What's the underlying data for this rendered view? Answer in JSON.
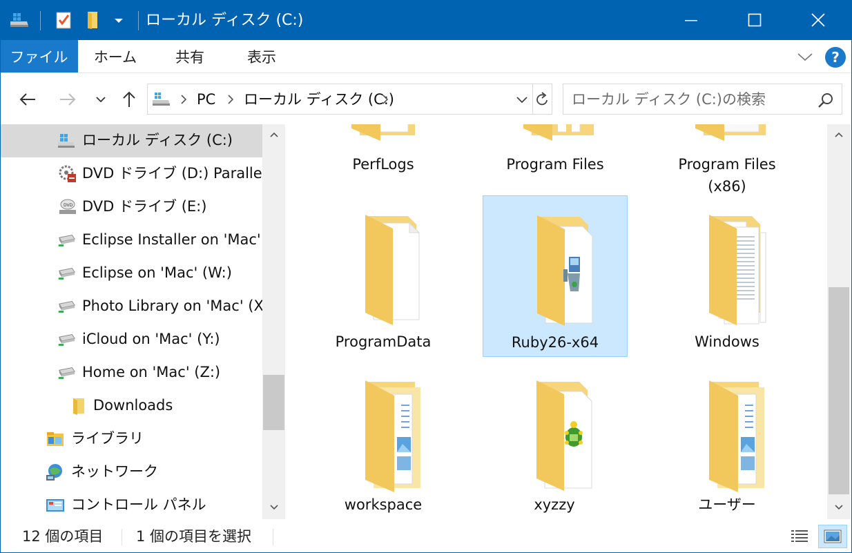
{
  "window": {
    "title": "ローカル ディスク (C:)",
    "accent": "#0063b1",
    "buttons": [
      "minimize-icon",
      "maximize-icon",
      "close-icon"
    ]
  },
  "quick_access": [
    "drive-icon",
    "properties-icon",
    "new-folder-icon",
    "customize-dropdown-icon"
  ],
  "ribbon": {
    "tabs": [
      "ファイル",
      "ホーム",
      "共有",
      "表示"
    ],
    "help": "?"
  },
  "address": {
    "breadcrumbs": [
      "PC",
      "ローカル ディスク (C:)"
    ],
    "search_placeholder": "ローカル ディスク (C:)の検索"
  },
  "nav": {
    "items": [
      {
        "label": "ローカル ディスク (C:)",
        "icon": "windows-drive-icon",
        "selected": true
      },
      {
        "label": "DVD ドライブ (D:) Parallels",
        "icon": "dvd-setup-icon"
      },
      {
        "label": "DVD ドライブ (E:)",
        "icon": "dvd-drive-icon"
      },
      {
        "label": "Eclipse Installer on 'Mac'",
        "icon": "network-drive-icon"
      },
      {
        "label": "Eclipse on 'Mac' (W:)",
        "icon": "network-drive-icon"
      },
      {
        "label": "Photo Library on 'Mac' (X",
        "icon": "network-drive-icon"
      },
      {
        "label": "iCloud on 'Mac' (Y:)",
        "icon": "network-drive-icon"
      },
      {
        "label": "Home on 'Mac' (Z:)",
        "icon": "network-drive-icon"
      },
      {
        "label": "Downloads",
        "icon": "folder-icon"
      },
      {
        "label": "ライブラリ",
        "icon": "library-icon"
      },
      {
        "label": "ネットワーク",
        "icon": "network-icon"
      },
      {
        "label": "コントロール パネル",
        "icon": "control-panel-icon"
      }
    ]
  },
  "files": [
    {
      "name": "PerfLogs",
      "icon": "folder-empty-icon"
    },
    {
      "name": "Program Files",
      "icon": "folder-files-icon"
    },
    {
      "name": "Program Files\n(x86)",
      "icon": "folder-docs-icon"
    },
    {
      "name": "ProgramData",
      "icon": "folder-empty-icon"
    },
    {
      "name": "Ruby26-x64",
      "icon": "folder-installer-icon",
      "selected": true
    },
    {
      "name": "Windows",
      "icon": "folder-docs-icon"
    },
    {
      "name": "workspace",
      "icon": "folder-pictures-icon"
    },
    {
      "name": "xyzzy",
      "icon": "folder-turtle-icon"
    },
    {
      "name": "ユーザー",
      "icon": "folder-pictures-icon"
    }
  ],
  "status": {
    "item_count": "12 個の項目",
    "selected_count": "1 個の項目を選択"
  },
  "views": [
    "details-view-icon",
    "large-icons-view-icon"
  ]
}
